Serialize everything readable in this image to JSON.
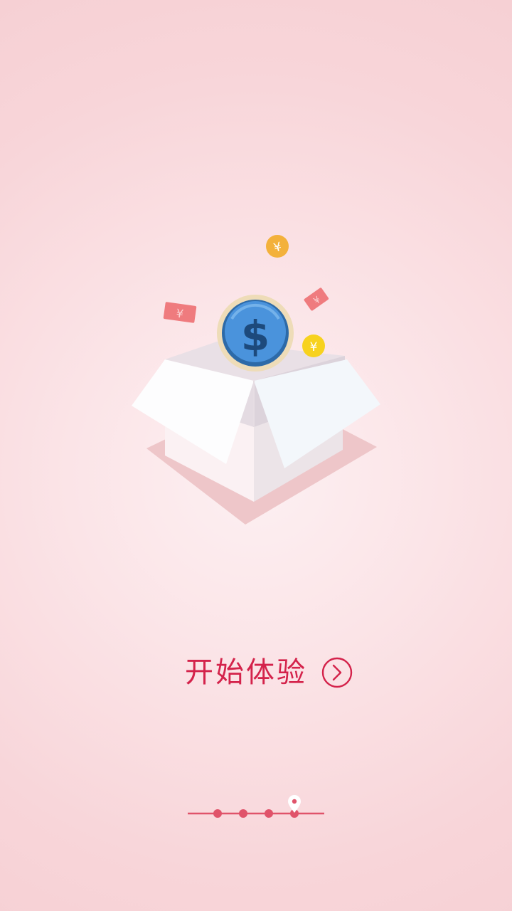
{
  "onboarding": {
    "start_label": "开始体验",
    "currency_dollar": "$",
    "currency_yuan": "¥"
  },
  "pager": {
    "total_pages": 4,
    "current_page": 4
  },
  "colors": {
    "accent": "#d4234b",
    "pager_line": "#e0536a",
    "coin_blue": "#3d86cf",
    "coin_gold": "#f3b13b",
    "coin_yellow": "#f7d21e",
    "ticket_red": "#ef7b7e"
  }
}
